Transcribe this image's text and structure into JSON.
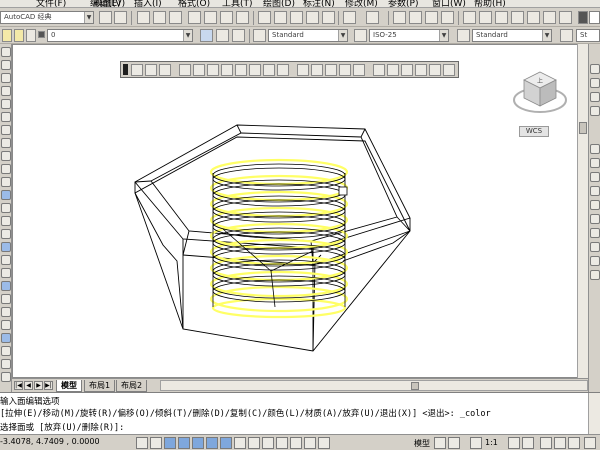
{
  "menu": {
    "items": [
      "文件(F)",
      "编辑(E)",
      "视图(V)",
      "插入(I)",
      "格式(O)",
      "工具(T)",
      "绘图(D)",
      "标注(N)",
      "修改(M)",
      "参数(P)",
      "窗口(W)",
      "帮助(H)"
    ]
  },
  "toolbar1": {
    "workspace": "AutoCAD 经典",
    "layer_value": "0"
  },
  "toolbar2": {
    "text_style": "Standard",
    "dim_style": "ISO-25",
    "table_style": "Standard",
    "multileader_style": "St"
  },
  "viewcube": {
    "label": "上",
    "wcs_label": "WCS"
  },
  "tabs": {
    "model": "模型",
    "layout1": "布局1",
    "layout2": "布局2"
  },
  "command": {
    "line1": "输入面编辑选项",
    "line2": "[拉伸(E)/移动(M)/旋转(R)/偏移(O)/倾斜(T)/删除(D)/复制(C)/颜色(L)/材质(A)/放弃(U)/退出(X)] <退出>: _color",
    "line3": "选择面或 [放弃(U)/删除(R)]:"
  },
  "status": {
    "coords": "-3.4078, 4.7409 , 0.0000",
    "model_label": "模型",
    "annotation_scale": "1:1"
  },
  "colors": {
    "highlight": "#ffff66",
    "canvas": "#ffffff",
    "chrome": "#d4d0c8"
  }
}
